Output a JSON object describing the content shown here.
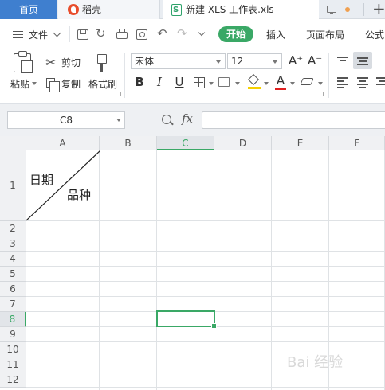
{
  "tabs": {
    "home": "首页",
    "docer": "稻壳",
    "file": "新建 XLS 工作表.xls",
    "new_tab": "+"
  },
  "menu": {
    "file": "文件",
    "start": "开始",
    "insert": "插入",
    "page_layout": "页面布局",
    "formula": "公式"
  },
  "ribbon": {
    "paste": "粘贴",
    "cut": "剪切",
    "copy": "复制",
    "format_painter": "格式刷",
    "font_name": "宋体",
    "font_size": "12",
    "bold": "B",
    "italic": "I",
    "underline": "U",
    "font_color_letter": "A",
    "grow_font": "A⁺",
    "shrink_font": "A⁻"
  },
  "formula_bar": {
    "name_box": "C8",
    "fx": "fx",
    "formula": ""
  },
  "grid": {
    "columns": [
      "A",
      "B",
      "C",
      "D",
      "E",
      "F"
    ],
    "rows": [
      "1",
      "2",
      "3",
      "4",
      "5",
      "6",
      "7",
      "8",
      "9",
      "10",
      "11",
      "12"
    ],
    "active_column": "C",
    "active_row": "8",
    "cell_a1_top": "日期",
    "cell_a1_bottom": "品种"
  },
  "watermark": "Bai 经验",
  "colors": {
    "accent_green": "#3aa866",
    "home_tab_blue": "#3f7fcf",
    "highlight_yellow": "#f6d000",
    "font_red": "#e02020"
  }
}
